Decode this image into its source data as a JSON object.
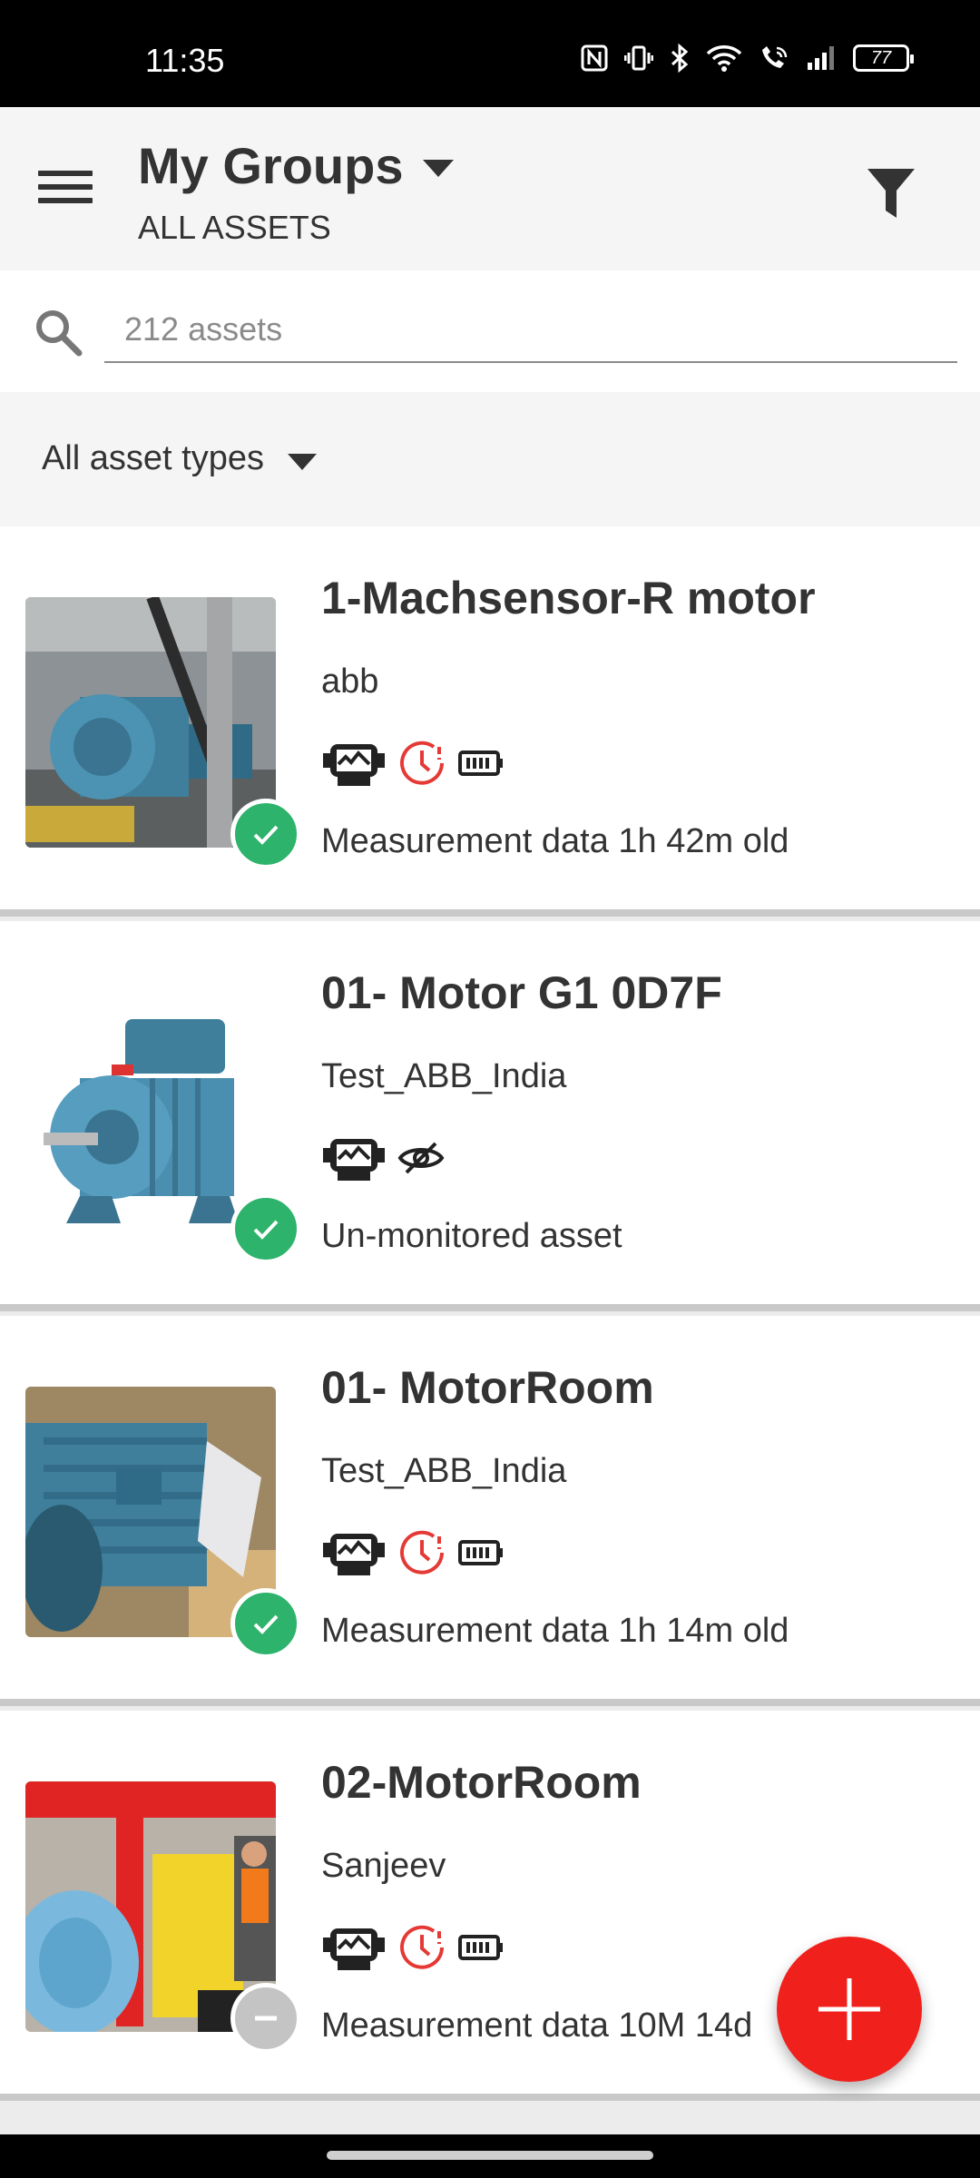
{
  "status_bar": {
    "time": "11:35",
    "battery": "77"
  },
  "header": {
    "title": "My Groups",
    "subtitle": "ALL ASSETS"
  },
  "search": {
    "placeholder": "212 assets"
  },
  "asset_type_filter": {
    "selected": "All asset types"
  },
  "assets": [
    {
      "name": " 1-Machsensor-R motor",
      "owner": "abb",
      "status": "Measurement data 1h 42m old",
      "icons": [
        "monitor-icon",
        "clock-alert-icon",
        "battery-icon"
      ],
      "badge": "check"
    },
    {
      "name": "01- Motor G1 0D7F",
      "owner": "Test_ABB_India",
      "status": "Un-monitored asset",
      "icons": [
        "monitor-icon",
        "eye-off-icon"
      ],
      "badge": "check"
    },
    {
      "name": "01- MotorRoom",
      "owner": "Test_ABB_India",
      "status": "Measurement data 1h 14m old",
      "icons": [
        "monitor-icon",
        "clock-alert-icon",
        "battery-icon"
      ],
      "badge": "check"
    },
    {
      "name": "02-MotorRoom",
      "owner": "Sanjeev",
      "status": "Measurement data 10M 14d",
      "icons": [
        "monitor-icon",
        "clock-alert-icon",
        "battery-icon"
      ],
      "badge": "minus"
    }
  ],
  "colors": {
    "ok_badge": "#2db36b",
    "inactive_badge": "#c4c4c4",
    "fab": "#f0201c",
    "alert": "#e53935"
  }
}
